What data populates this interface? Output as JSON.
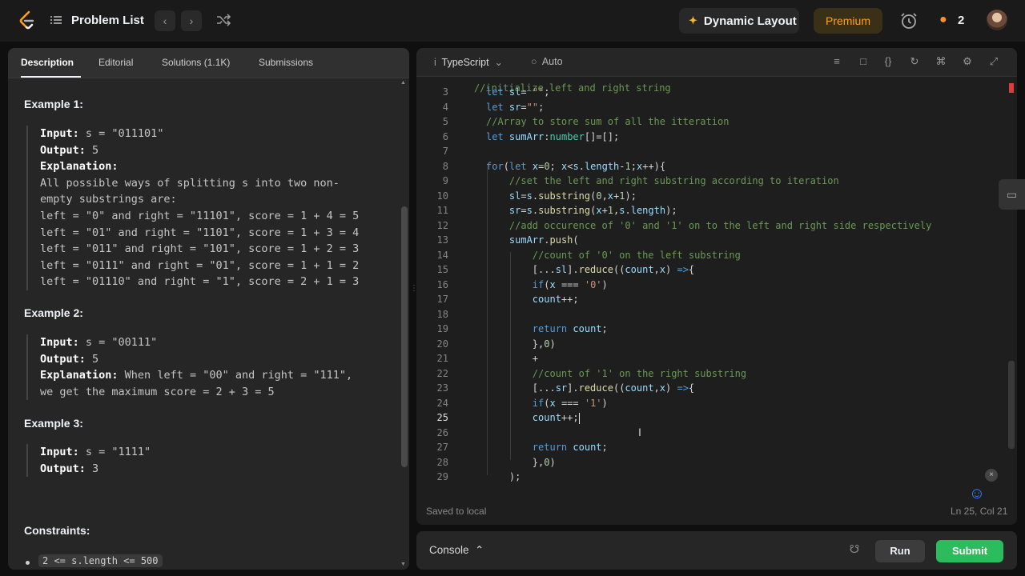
{
  "topbar": {
    "problem_list": "Problem List",
    "dynamic_layout": "Dynamic Layout",
    "premium": "Premium",
    "streak": "2"
  },
  "left": {
    "tabs": [
      "Description",
      "Editorial",
      "Solutions (1.1K)",
      "Submissions"
    ],
    "ex1_title": "Example 1:",
    "ex1_lines": [
      {
        "label": "Input:",
        "text": " s = \"011101\""
      },
      {
        "label": "Output:",
        "text": " 5"
      },
      {
        "label": "Explanation:",
        "text": ""
      },
      {
        "label": "",
        "text": "All possible ways of splitting s into two non-"
      },
      {
        "label": "",
        "text": "empty substrings are:"
      },
      {
        "label": "",
        "text": "left = \"0\" and right = \"11101\", score = 1 + 4 = 5"
      },
      {
        "label": "",
        "text": "left = \"01\" and right = \"1101\", score = 1 + 3 = 4"
      },
      {
        "label": "",
        "text": "left = \"011\" and right = \"101\", score = 1 + 2 = 3"
      },
      {
        "label": "",
        "text": "left = \"0111\" and right = \"01\", score = 1 + 1 = 2"
      },
      {
        "label": "",
        "text": "left = \"01110\" and right = \"1\", score = 2 + 1 = 3"
      }
    ],
    "ex2_title": "Example 2:",
    "ex2_lines": [
      {
        "label": "Input:",
        "text": " s = \"00111\""
      },
      {
        "label": "Output:",
        "text": " 5"
      },
      {
        "label": "Explanation:",
        "text": " When left = \"00\" and right = \"111\","
      },
      {
        "label": "",
        "text": "we get the maximum score = 2 + 3 = 5"
      }
    ],
    "ex3_title": "Example 3:",
    "ex3_lines": [
      {
        "label": "Input:",
        "text": " s = \"1111\""
      },
      {
        "label": "Output:",
        "text": " 3"
      }
    ],
    "constraints_title": "Constraints:",
    "constraint_1": "2 <= s.length <= 500"
  },
  "editor": {
    "language": "TypeScript",
    "mode": "Auto",
    "partial_top": "//initialize left and right string",
    "code_lines": [
      {
        "n": "3",
        "html": "<span class=\"kw\">let</span> <span class=\"vr\">sl</span>= <span class=\"st\">\"\"</span>;"
      },
      {
        "n": "4",
        "html": "<span class=\"kw\">let</span> <span class=\"vr\">sr</span>=<span class=\"st\">\"\"</span>;"
      },
      {
        "n": "5",
        "html": "<span class=\"cm\">//Array to store sum of all the itteration</span>"
      },
      {
        "n": "6",
        "html": "<span class=\"kw\">let</span> <span class=\"vr\">sumArr</span>:<span class=\"ty\">number</span>[]=[];"
      },
      {
        "n": "7",
        "html": ""
      },
      {
        "n": "8",
        "html": "<span class=\"kw\">for</span>(<span class=\"kw\">let</span> <span class=\"vr\">x</span>=<span class=\"nm\">0</span>; <span class=\"vr\">x</span>&lt;<span class=\"vr\">s</span>.<span class=\"vr\">length</span>-<span class=\"nm\">1</span>;<span class=\"vr\">x</span>++){"
      },
      {
        "n": "9",
        "html": "    <span class=\"cm\">//set the left and right substring according to iteration</span>"
      },
      {
        "n": "10",
        "html": "    <span class=\"vr\">sl</span>=<span class=\"vr\">s</span>.<span class=\"fn\">substring</span>(<span class=\"nm\">0</span>,<span class=\"vr\">x</span>+<span class=\"nm\">1</span>);"
      },
      {
        "n": "11",
        "html": "    <span class=\"vr\">sr</span>=<span class=\"vr\">s</span>.<span class=\"fn\">substring</span>(<span class=\"vr\">x</span>+<span class=\"nm\">1</span>,<span class=\"vr\">s</span>.<span class=\"vr\">length</span>);"
      },
      {
        "n": "12",
        "html": "    <span class=\"cm\">//add occurence of '0' and '1' on to the left and right side respectively</span>"
      },
      {
        "n": "13",
        "html": "    <span class=\"vr\">sumArr</span>.<span class=\"fn\">push</span>("
      },
      {
        "n": "14",
        "html": "        <span class=\"cm\">//count of '0' on the left substring</span>"
      },
      {
        "n": "15",
        "html": "        [...<span class=\"vr\">sl</span>].<span class=\"fn\">reduce</span>((<span class=\"vr\">count</span>,<span class=\"vr\">x</span>) <span class=\"kw\">=&gt;</span>{"
      },
      {
        "n": "16",
        "html": "        <span class=\"kw\">if</span>(<span class=\"vr\">x</span> === <span class=\"st\">'0'</span>)"
      },
      {
        "n": "17",
        "html": "        <span class=\"vr\">count</span>++;"
      },
      {
        "n": "18",
        "html": ""
      },
      {
        "n": "19",
        "html": "        <span class=\"kw\">return</span> <span class=\"vr\">count</span>;"
      },
      {
        "n": "20",
        "html": "        },<span class=\"nm\">0</span>)"
      },
      {
        "n": "21",
        "html": "        +"
      },
      {
        "n": "22",
        "html": "        <span class=\"cm\">//count of '1' on the right substring</span>"
      },
      {
        "n": "23",
        "html": "        [...<span class=\"vr\">sr</span>].<span class=\"fn\">reduce</span>((<span class=\"vr\">count</span>,<span class=\"vr\">x</span>) <span class=\"kw\">=&gt;</span>{"
      },
      {
        "n": "24",
        "html": "        <span class=\"kw\">if</span>(<span class=\"vr\">x</span> === <span class=\"st\">'1'</span>)"
      },
      {
        "n": "25",
        "html": "        <span class=\"vr\">count</span>++;<span class=\"cursor-caret\"></span>"
      },
      {
        "n": "26",
        "html": ""
      },
      {
        "n": "27",
        "html": "        <span class=\"kw\">return</span> <span class=\"vr\">count</span>;"
      },
      {
        "n": "28",
        "html": "        },<span class=\"nm\">0</span>)"
      },
      {
        "n": "29",
        "html": "    );"
      }
    ],
    "current_line": "25",
    "saved": "Saved to local",
    "position": "Ln 25, Col 21"
  },
  "console": {
    "label": "Console",
    "run": "Run",
    "submit": "Submit"
  },
  "colors": {
    "accent_green": "#2cbb5d",
    "premium_orange": "#ffa116"
  }
}
